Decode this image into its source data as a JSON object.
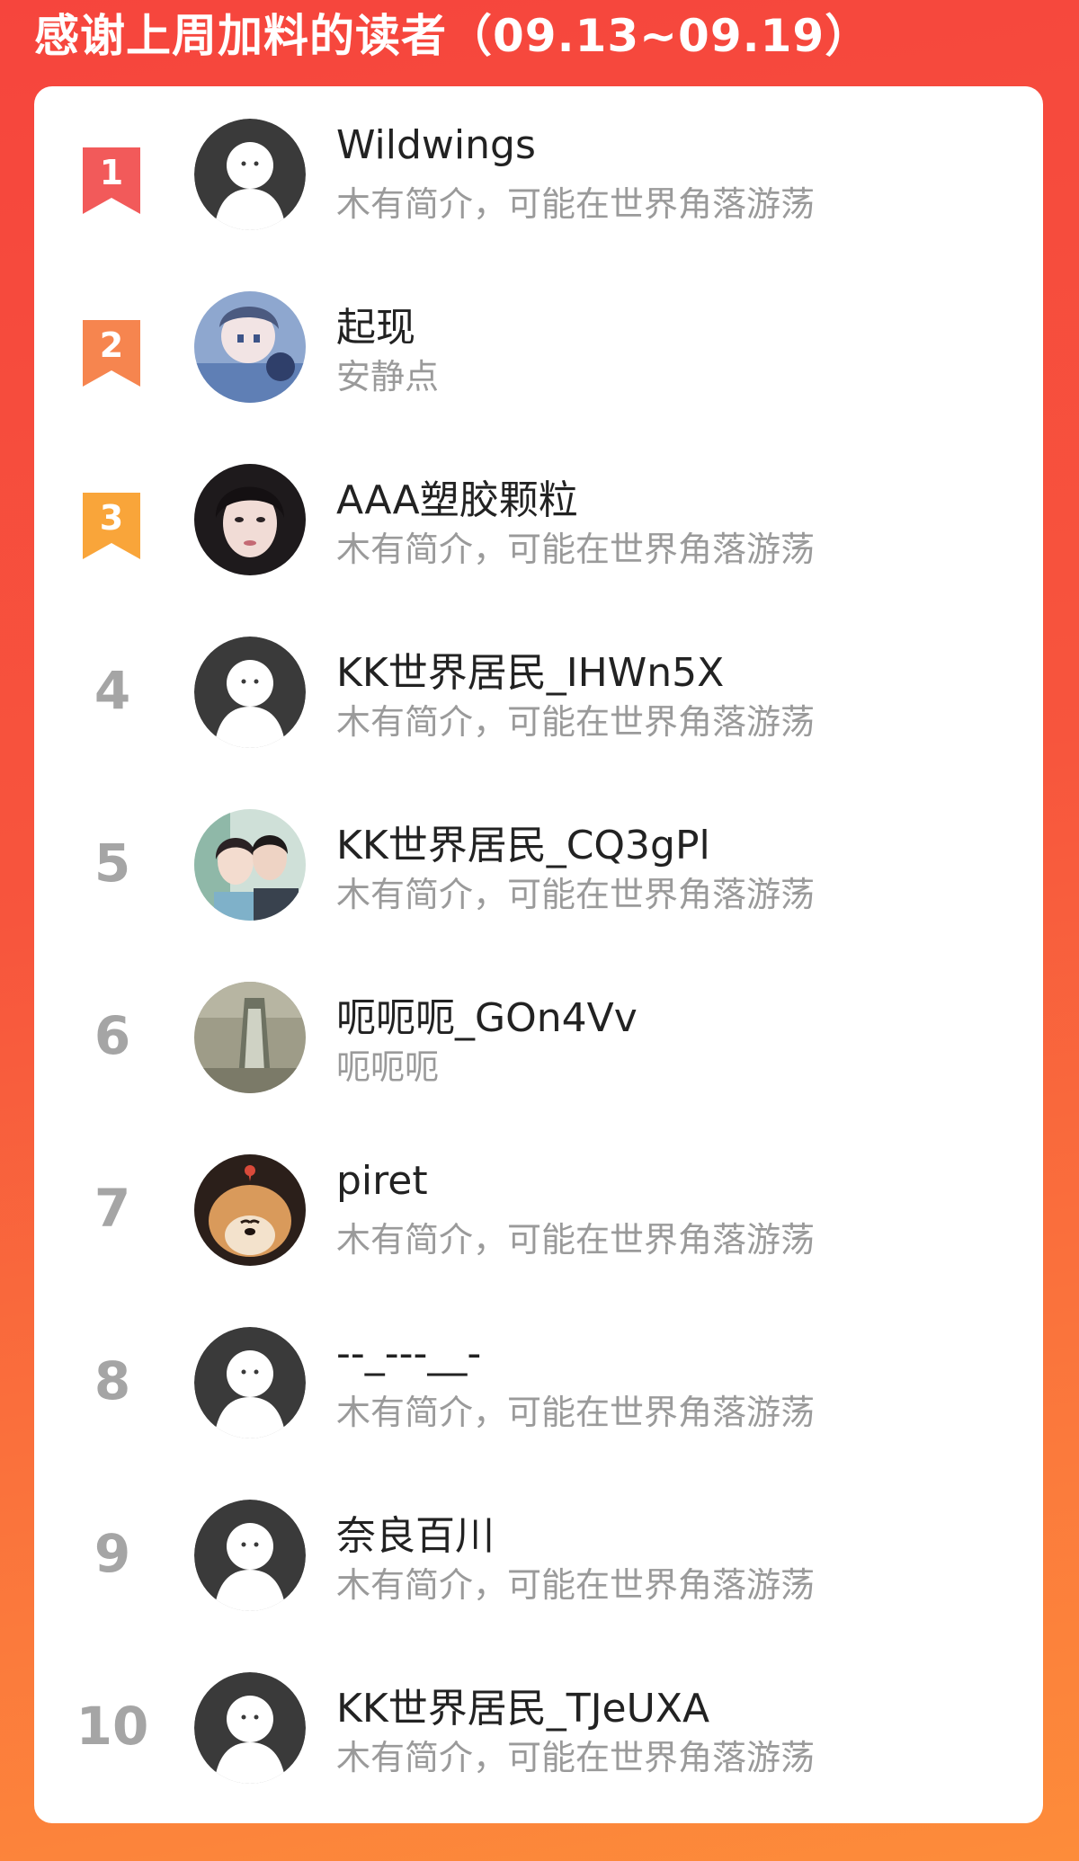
{
  "header": {
    "title": "感谢上周加料的读者（09.13~09.19）"
  },
  "colors": {
    "background_top": "#f6453d",
    "background_bottom": "#fd8c3a",
    "rank1": "#f25a5a",
    "rank2": "#f6854f",
    "rank3": "#f9a53a",
    "rank_plain": "#a5a5a5",
    "default_avatar": "#3a3a3a"
  },
  "readers": [
    {
      "rank": "1",
      "name": "Wildwings",
      "bio": "木有简介，可能在世界角落游荡",
      "avatar": "default-avatar-icon"
    },
    {
      "rank": "2",
      "name": "起现",
      "bio": "安静点",
      "avatar": "anime-avatar"
    },
    {
      "rank": "3",
      "name": "AAA塑胶颗粒",
      "bio": "木有简介，可能在世界角落游荡",
      "avatar": "portrait-avatar"
    },
    {
      "rank": "4",
      "name": "KK世界居民_IHWn5X",
      "bio": "木有简介，可能在世界角落游荡",
      "avatar": "default-avatar-icon"
    },
    {
      "rank": "5",
      "name": "KK世界居民_CQ3gPl",
      "bio": "木有简介，可能在世界角落游荡",
      "avatar": "couple-photo-avatar"
    },
    {
      "rank": "6",
      "name": "呃呃呃_GOn4Vv",
      "bio": "呃呃呃",
      "avatar": "photo-avatar"
    },
    {
      "rank": "7",
      "name": "piret",
      "bio": "木有简介，可能在世界角落游荡",
      "avatar": "shiba-dog-avatar"
    },
    {
      "rank": "8",
      "name": "--_---__-",
      "bio": "木有简介，可能在世界角落游荡",
      "avatar": "default-avatar-icon"
    },
    {
      "rank": "9",
      "name": "奈良百川",
      "bio": "木有简介，可能在世界角落游荡",
      "avatar": "default-avatar-icon"
    },
    {
      "rank": "10",
      "name": "KK世界居民_TJeUXA",
      "bio": "木有简介，可能在世界角落游荡",
      "avatar": "default-avatar-icon"
    }
  ]
}
